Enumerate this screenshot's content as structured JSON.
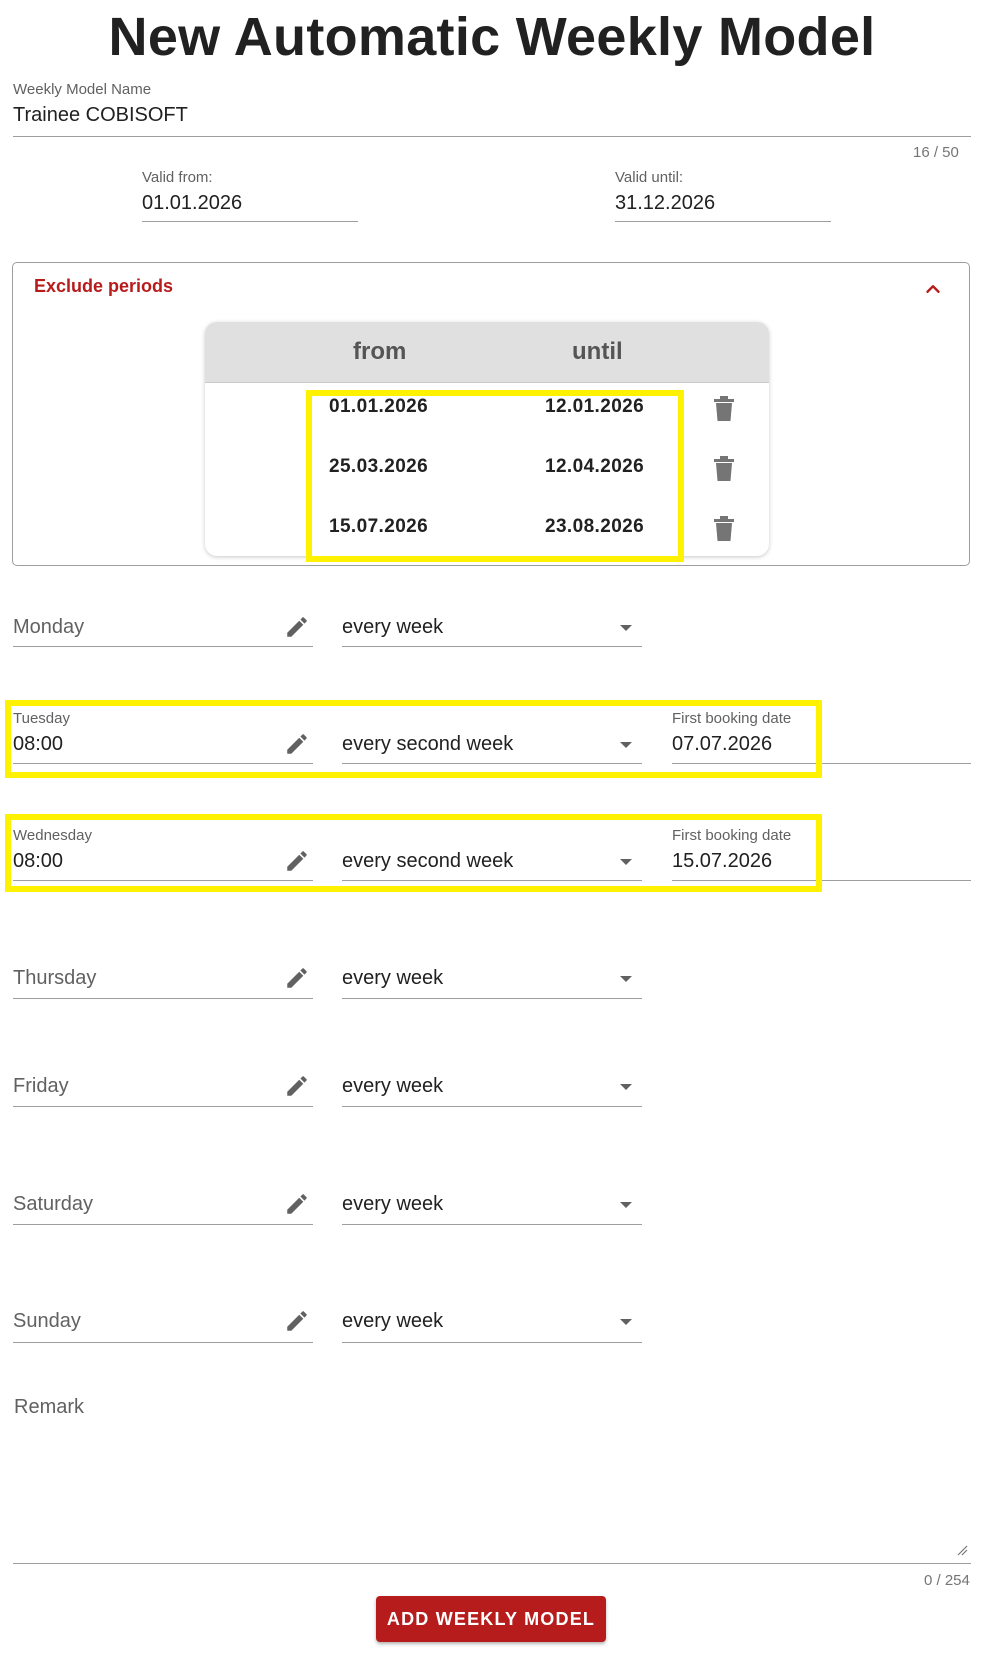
{
  "page_title": "New Automatic Weekly Model",
  "name_field": {
    "label": "Weekly Model Name",
    "value": "Trainee COBISOFT",
    "counter": "16 / 50"
  },
  "valid_from": {
    "label": "Valid from:",
    "value": "01.01.2026"
  },
  "valid_until": {
    "label": "Valid until:",
    "value": "31.12.2026"
  },
  "exclude_periods": {
    "title": "Exclude periods",
    "columns": [
      "from",
      "until"
    ],
    "rows": [
      {
        "from": "01.01.2026",
        "until": "12.01.2026"
      },
      {
        "from": "25.03.2026",
        "until": "12.04.2026"
      },
      {
        "from": "15.07.2026",
        "until": "23.08.2026"
      }
    ]
  },
  "days": [
    {
      "label": "Monday",
      "time": "",
      "frequency": "every week",
      "first_booking_label": "",
      "first_booking_date": ""
    },
    {
      "label": "Tuesday",
      "time": "08:00",
      "frequency": "every second week",
      "first_booking_label": "First booking date",
      "first_booking_date": "07.07.2026"
    },
    {
      "label": "Wednesday",
      "time": "08:00",
      "frequency": "every second week",
      "first_booking_label": "First booking date",
      "first_booking_date": "15.07.2026"
    },
    {
      "label": "Thursday",
      "time": "",
      "frequency": "every week",
      "first_booking_label": "",
      "first_booking_date": ""
    },
    {
      "label": "Friday",
      "time": "",
      "frequency": "every week",
      "first_booking_label": "",
      "first_booking_date": ""
    },
    {
      "label": "Saturday",
      "time": "",
      "frequency": "every week",
      "first_booking_label": "",
      "first_booking_date": ""
    },
    {
      "label": "Sunday",
      "time": "",
      "frequency": "every week",
      "first_booking_label": "",
      "first_booking_date": ""
    }
  ],
  "remark": {
    "label": "Remark",
    "value": "",
    "counter": "0 / 254"
  },
  "submit_label": "ADD WEEKLY MODEL",
  "colors": {
    "accent": "#b71c1c",
    "highlight": "#fff200",
    "header_bg": "#e0e0e0",
    "icon": "#757575"
  },
  "icons": {
    "collapse": "chevron-up-icon",
    "delete": "trash-icon",
    "edit": "pencil-icon",
    "dropdown": "caret-down-icon"
  }
}
